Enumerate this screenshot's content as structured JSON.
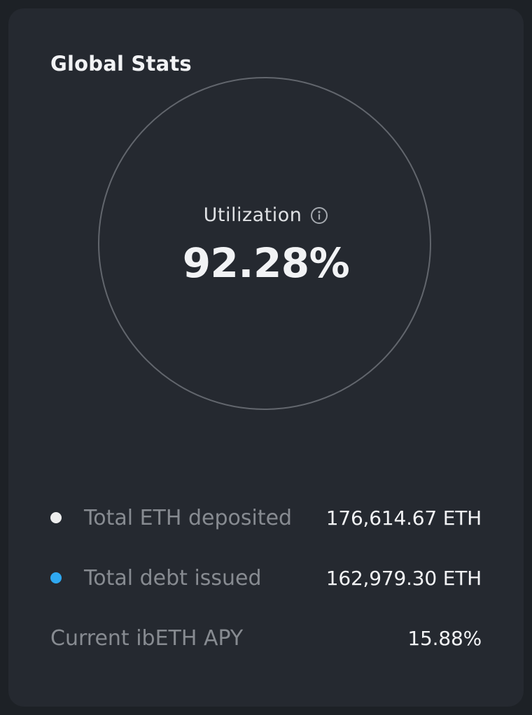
{
  "card": {
    "title": "Global Stats"
  },
  "utilization": {
    "label": "Utilization",
    "value": "92.28%",
    "info_icon": "info-circle-icon",
    "fraction": 0.9228
  },
  "stats": [
    {
      "label": "Total ETH deposited",
      "value": "176,614.67 ETH",
      "dot_color": "#eeeeee"
    },
    {
      "label": "Total debt issued",
      "value": "162,979.30 ETH",
      "dot_color": "#2fa8f0"
    },
    {
      "label": "Current ibETH APY",
      "value": "15.88%"
    }
  ],
  "colors": {
    "background": "#1d2126",
    "card": "#252930",
    "text_primary": "#f2f3f5",
    "text_muted": "#878b91",
    "ring": "#62666d"
  }
}
